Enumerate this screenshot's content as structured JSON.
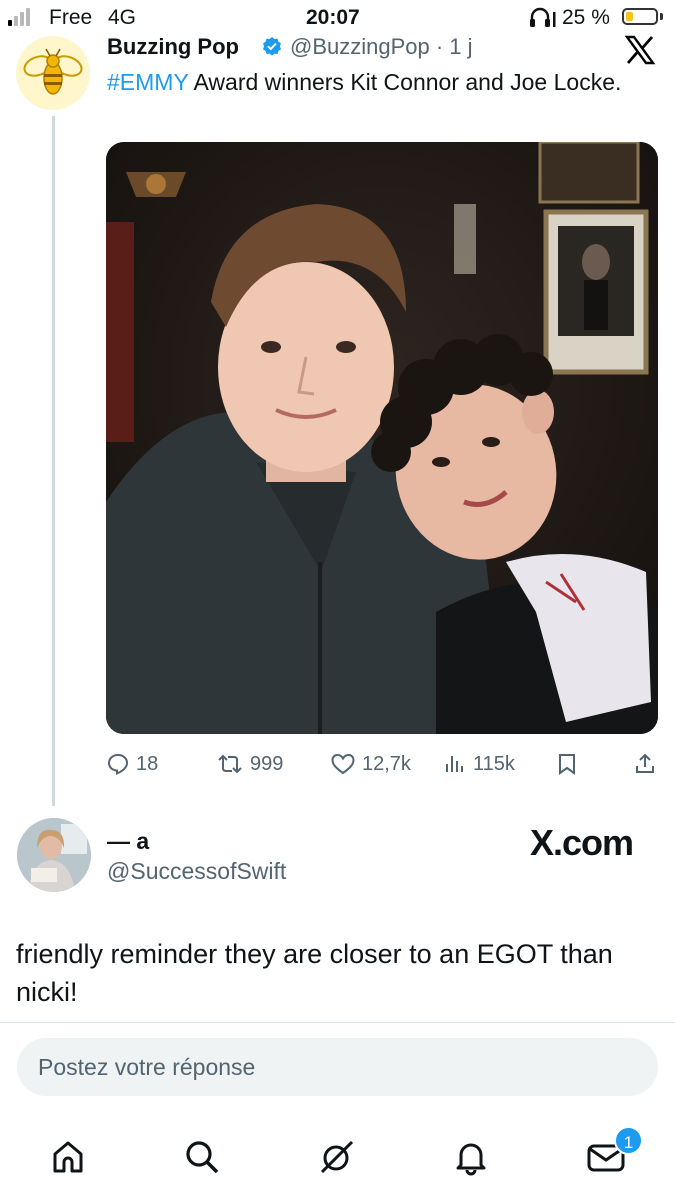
{
  "status_bar": {
    "carrier": "Free",
    "network": "4G",
    "time": "20:07",
    "battery_percent": "25 %",
    "battery_level": 0.25,
    "signal_bars_active": 1,
    "colors": {
      "battery_fill": "#f5c518"
    }
  },
  "tweet": {
    "author_name": "Buzzing Pop",
    "handle_time": "@BuzzingPop · 1 j",
    "verified_icon": "verified-badge-icon",
    "hashtag": "#EMMY",
    "text": " Award winners Kit Connor and Joe Locke.",
    "avatar_icon": "bee-logo-icon",
    "media_icon": "photo-two-people",
    "actions": {
      "replies": "18",
      "retweets": "999",
      "likes": "12,7k",
      "views": "115k"
    }
  },
  "reply": {
    "author_name": "— a",
    "handle": "@SuccessofSwift",
    "watermark": "X.com",
    "text": "friendly reminder they are closer to an EGOT than nicki!"
  },
  "composer": {
    "placeholder": "Postez votre réponse"
  },
  "bottom_nav": {
    "items": [
      "home-icon",
      "search-icon",
      "grok-icon",
      "notifications-icon",
      "messages-icon"
    ],
    "messages_badge": "1"
  },
  "colors": {
    "accent": "#1d9bf0",
    "secondary_text": "#536471",
    "thread_line": "#cfd9de"
  }
}
